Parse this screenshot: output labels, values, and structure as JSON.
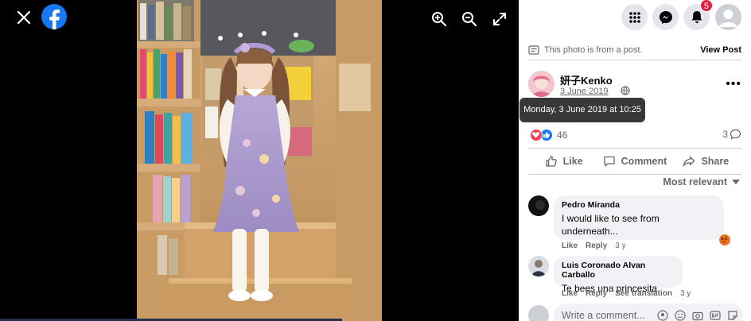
{
  "colors": {
    "accent": "#1877f2",
    "badge": "#e41e3f",
    "panel_bg": "#ffffff",
    "viewer_bg": "#000000"
  },
  "viewer": {
    "close_icon": "close-icon",
    "brand_icon": "facebook-logo",
    "tools": [
      "zoom-in-icon",
      "zoom-out-icon",
      "fullscreen-icon"
    ]
  },
  "topbar": {
    "icons": [
      "menu-grid-icon",
      "messenger-icon",
      "notifications-icon",
      "account-avatar"
    ],
    "notifications_badge": "5"
  },
  "post": {
    "from_post_text": "This photo is from a post.",
    "view_post_label": "View Post",
    "author_name": "妍子Kenko",
    "date": "3 June 2019",
    "tooltip": "Monday, 3 June 2019 at 10:25",
    "reaction_count": "46",
    "comment_count": "3"
  },
  "actions": {
    "like": "Like",
    "comment": "Comment",
    "share": "Share"
  },
  "sort_label": "Most relevant",
  "comments": [
    {
      "name": "Pedro Miranda",
      "text_line1": "I would like to see from",
      "text_line2": "underneath...",
      "like": "Like",
      "reply": "Reply",
      "time": "3 y"
    },
    {
      "name": "Luis Coronado Alvan Carballo",
      "text_line1": "Te bees una princesita",
      "like": "Like",
      "reply": "Reply",
      "see_translation": "See translation",
      "time": "3 y"
    }
  ],
  "write_placeholder": "Write a comment..."
}
